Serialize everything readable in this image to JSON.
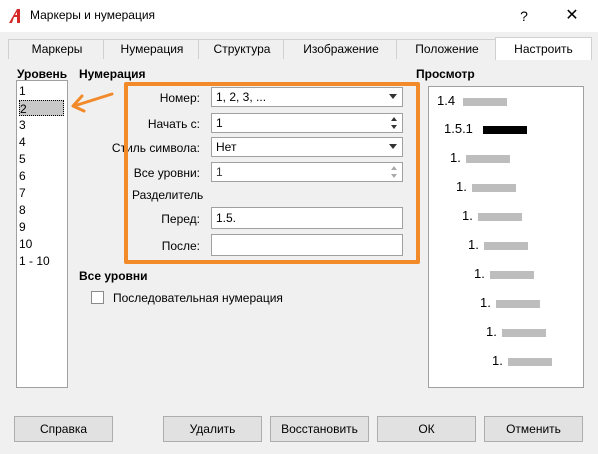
{
  "window": {
    "title": "Маркеры и нумерация",
    "help_glyph": "?",
    "close_glyph": "✕"
  },
  "tabs": [
    {
      "label": "Маркеры"
    },
    {
      "label": "Нумерация"
    },
    {
      "label": "Структура"
    },
    {
      "label": "Изображение"
    },
    {
      "label": "Положение"
    },
    {
      "label": "Настроить",
      "active": true
    }
  ],
  "level": {
    "heading": "Уровень",
    "items": [
      "1",
      "2",
      "3",
      "4",
      "5",
      "6",
      "7",
      "8",
      "9",
      "10",
      "1 - 10"
    ],
    "selected": "2"
  },
  "numbering": {
    "heading": "Нумерация",
    "number_label": "Номер:",
    "number_value": "1, 2, 3, ...",
    "start_label": "Начать с:",
    "start_value": "1",
    "symbol_style_label": "Стиль символа:",
    "symbol_style_value": "Нет",
    "all_levels_label": "Все уровни:",
    "all_levels_value": "1",
    "separator_heading": "Разделитель",
    "before_label": "Перед:",
    "before_value": "1.5.",
    "after_label": "После:",
    "after_value": ""
  },
  "all_levels": {
    "heading": "Все уровни",
    "sequential_label": "Последовательная нумерация",
    "sequential_checked": false
  },
  "preview": {
    "heading": "Просмотр",
    "lines": [
      {
        "label": "1.4"
      },
      {
        "label": "1.5.1",
        "highlight": true
      },
      {
        "label": "1."
      },
      {
        "label": "1."
      },
      {
        "label": "1."
      },
      {
        "label": "1."
      },
      {
        "label": "1."
      },
      {
        "label": "1."
      },
      {
        "label": "1."
      },
      {
        "label": "1."
      }
    ]
  },
  "buttons": {
    "help": "Справка",
    "delete": "Удалить",
    "restore": "Восстановить",
    "ok": "ОК",
    "cancel": "Отменить"
  },
  "colors": {
    "annotation": "#f28a2a",
    "app_icon": "#d62a2a"
  },
  "icons": {
    "app": "app-logo-icon",
    "arrow": "annotation-arrow-icon"
  }
}
